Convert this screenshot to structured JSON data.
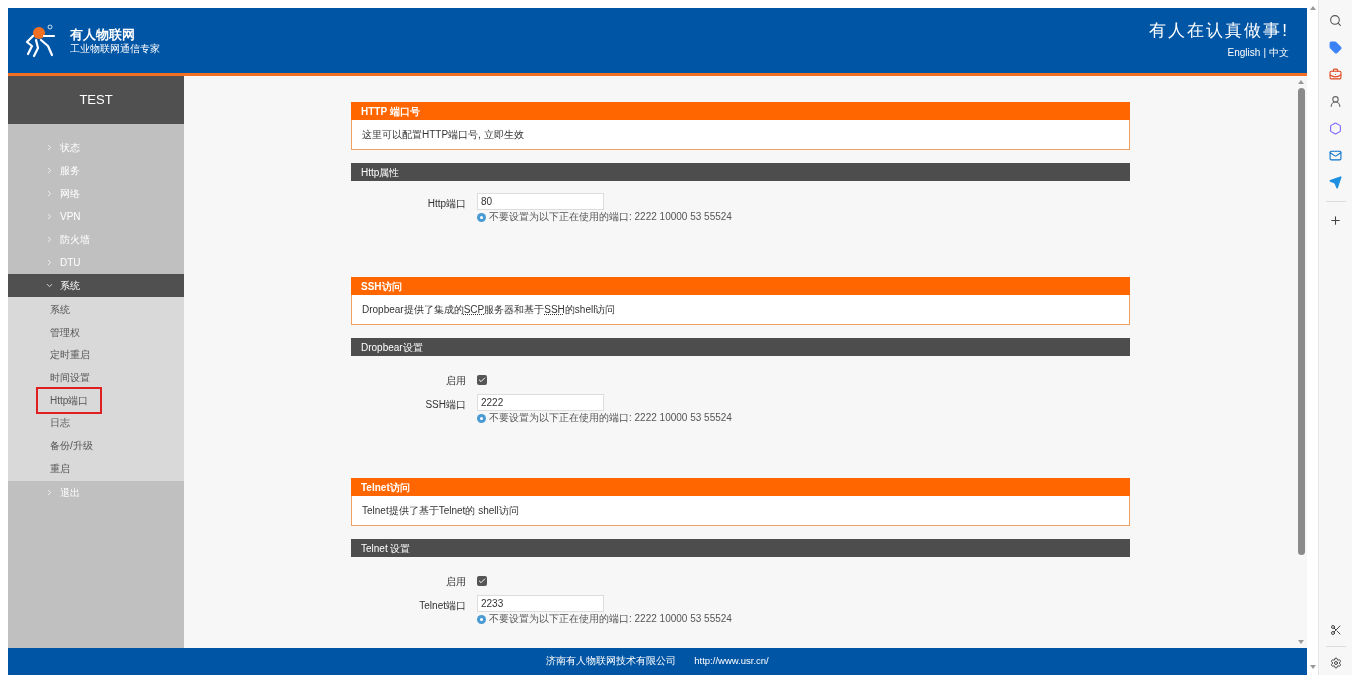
{
  "header": {
    "brand": "有人物联网",
    "tagline": "工业物联网通信专家",
    "slogan": "有人在认真做事!",
    "languages": [
      "English",
      "中文"
    ],
    "language_separator": "|"
  },
  "sidebar": {
    "title": "TEST",
    "items": [
      {
        "label": "状态",
        "expanded": false
      },
      {
        "label": "服务",
        "expanded": false
      },
      {
        "label": "网络",
        "expanded": false
      },
      {
        "label": "VPN",
        "expanded": false
      },
      {
        "label": "防火墙",
        "expanded": false
      },
      {
        "label": "DTU",
        "expanded": false
      },
      {
        "label": "系统",
        "expanded": true,
        "children": [
          {
            "label": "系统",
            "selected": false
          },
          {
            "label": "管理权",
            "selected": false
          },
          {
            "label": "定时重启",
            "selected": false
          },
          {
            "label": "时间设置",
            "selected": false
          },
          {
            "label": "Http端口",
            "selected": true
          },
          {
            "label": "日志",
            "selected": false
          },
          {
            "label": "备份/升级",
            "selected": false
          },
          {
            "label": "重启",
            "selected": false
          }
        ]
      },
      {
        "label": "退出",
        "expanded": false
      }
    ]
  },
  "sections": [
    {
      "title": "HTTP 端口号",
      "description": [
        {
          "kind": "text",
          "text": "这里可以配置HTTP端口号, 立即生效"
        }
      ],
      "settings_title": "Http属性",
      "fields": [
        {
          "kind": "text",
          "label": "Http端口",
          "value": "80",
          "hint": "不要设置为以下正在使用的端口: 2222 10000 53 55524"
        }
      ]
    },
    {
      "title": "SSH访问",
      "description": [
        {
          "kind": "text",
          "text": "Dropbear提供了集成的"
        },
        {
          "kind": "abbr",
          "text": "SCP"
        },
        {
          "kind": "text",
          "text": "服务器和基于"
        },
        {
          "kind": "abbr",
          "text": "SSH"
        },
        {
          "kind": "text",
          "text": "的shell访问"
        }
      ],
      "settings_title": "Dropbear设置",
      "fields": [
        {
          "kind": "checkbox",
          "label": "启用",
          "checked": true
        },
        {
          "kind": "text",
          "label": "SSH端口",
          "value": "2222",
          "hint": "不要设置为以下正在使用的端口: 2222 10000 53 55524"
        }
      ]
    },
    {
      "title": "Telnet访问",
      "description": [
        {
          "kind": "text",
          "text": "Telnet提供了基于Telnet的 shell访问"
        }
      ],
      "settings_title": "Telnet 设置",
      "fields": [
        {
          "kind": "checkbox",
          "label": "启用",
          "checked": true
        },
        {
          "kind": "text",
          "label": "Telnet端口",
          "value": "2233",
          "hint": "不要设置为以下正在使用的端口: 2222 10000 53 55524"
        }
      ]
    }
  ],
  "footer": {
    "company": "济南有人物联网技术有限公司",
    "url": "http://www.usr.cn/"
  }
}
